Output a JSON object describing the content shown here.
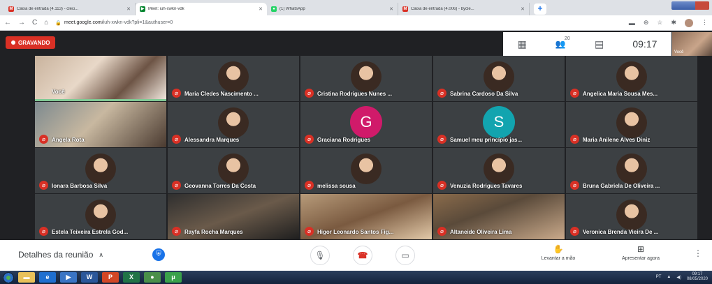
{
  "browser": {
    "tabs": [
      {
        "label": "Caixa de entrada (4.113) - cleci...",
        "icon": "gmail-icon",
        "color": "#d93025",
        "glyph": "M"
      },
      {
        "label": "Meet: iuh-xwkn-vdk",
        "icon": "meet-icon",
        "color": "#00832d",
        "glyph": "▶",
        "active": true
      },
      {
        "label": "(1) WhatsApp",
        "icon": "whatsapp-icon",
        "color": "#25d366",
        "glyph": "●"
      },
      {
        "label": "Caixa de entrada (4.006) - bycle...",
        "icon": "gmail-icon",
        "color": "#d93025",
        "glyph": "M"
      }
    ],
    "url_prefix": "meet.google.com/",
    "url_path": "iuh-xwkn-vdk?pli=1&authuser=0"
  },
  "meet": {
    "recording_label": "GRAVANDO",
    "participant_count": "20",
    "clock": "09:17",
    "self_label": "Você",
    "participants": [
      {
        "name": "Você",
        "kind": "video-self"
      },
      {
        "name": "Maria Cledes Nascimento ...",
        "kind": "face"
      },
      {
        "name": "Cristina Rodrigues Nunes ...",
        "kind": "face"
      },
      {
        "name": "Sabrina Cardoso Da Silva",
        "kind": "face"
      },
      {
        "name": "Angelica Maria Sousa Mes...",
        "kind": "face"
      },
      {
        "name": "Angela Rota",
        "kind": "video"
      },
      {
        "name": "Alessandra Marques",
        "kind": "face"
      },
      {
        "name": "Graciana Rodrigues",
        "kind": "letter",
        "letter": "G",
        "color": "#d01a6a"
      },
      {
        "name": "Samuel meu princípio jas...",
        "kind": "letter",
        "letter": "S",
        "color": "#12a4af"
      },
      {
        "name": "Maria Anilene Alves Diniz",
        "kind": "face"
      },
      {
        "name": "Ionara Barbosa Silva",
        "kind": "face"
      },
      {
        "name": "Geovanna Torres Da Costa",
        "kind": "face"
      },
      {
        "name": "melissa sousa",
        "kind": "face"
      },
      {
        "name": "Venuzia Rodrigues Tavares",
        "kind": "face"
      },
      {
        "name": "Bruna Gabriela De Oliveira ...",
        "kind": "face"
      },
      {
        "name": "Estela Teixeira Estrela God...",
        "kind": "face"
      },
      {
        "name": "Rayfa Rocha Marques",
        "kind": "video"
      },
      {
        "name": "Higor Leonardo Santos Fig...",
        "kind": "video"
      },
      {
        "name": "Altaneide Oliveira Lima",
        "kind": "video"
      },
      {
        "name": "Veronica Brenda Vieira De ...",
        "kind": "face"
      }
    ]
  },
  "bottom": {
    "details_label": "Detalhes da reunião",
    "raise_hand_label": "Levantar a mão",
    "present_label": "Apresentar agora"
  },
  "taskbar": {
    "lang": "PT",
    "time": "09:17",
    "date": "08/05/2020"
  }
}
